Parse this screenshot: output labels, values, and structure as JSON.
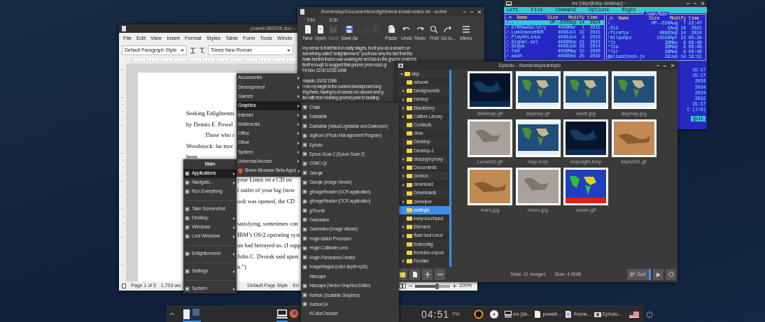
{
  "writer": {
    "title": "powell-082025.doc —",
    "menu": [
      "File",
      "Edit",
      "View",
      "Insert",
      "Format",
      "Styles",
      "Table",
      "Form",
      "Tools",
      "Windo"
    ],
    "paragraph_style": "Default Paragraph Style",
    "font_name": "Times New Roman",
    "paragraphs": [
      {
        "lines": [
          {
            "text": "Seeking Enlightenm",
            "indent": false
          },
          {
            "text": "by Dennis E. Powel",
            "indent": false
          },
          {
            "text": "Those who r",
            "indent": true
          },
          {
            "text": "Woodstock: far mor",
            "indent": false
          },
          {
            "text": "been.",
            "indent": false
          }
        ]
      },
      {
        "lines": [
          {
            "text": "your Linux on a CD ou",
            "indent": false
          },
          {
            "text": "l outlet of your big (now",
            "indent": false
          },
          {
            "text": "ook was opened, the CD",
            "indent": false
          }
        ]
      },
      {
        "lines": [
          {
            "text": "satisfying, sometimes con",
            "indent": false
          },
          {
            "text": "IBM’s OS/2 operating syst",
            "indent": false
          },
          {
            "text": "un had betrayed us. (I supp",
            "indent": false
          },
          {
            "text": "John C. Dvorak said upon",
            "indent": false
          },
          {
            "text": "n.”)",
            "indent": false
          }
        ]
      }
    ],
    "status": {
      "page": "Page 1 of 5",
      "words": "1,703 wo",
      "page_style": "Default Page Style",
      "language": "En"
    },
    "zoom": {
      "level": 0.62,
      "reading": "100%"
    }
  },
  "editor": {
    "title": "/home/dep/Documents/enlightment-email-notes.txt - ecrire",
    "menu": [
      "File",
      "Edit"
    ],
    "toolbar": [
      {
        "kind": "new",
        "label": "New",
        "disabled": false
      },
      {
        "kind": "open",
        "label": "Open",
        "disabled": false
      },
      {
        "kind": "save",
        "label": "Save",
        "disabled": true
      },
      {
        "kind": "save-as",
        "label": "Save As",
        "disabled": false
      },
      {
        "kind": "cut",
        "disabled": true
      },
      {
        "kind": "copy",
        "disabled": true
      },
      {
        "kind": "paste",
        "label": "Paste",
        "disabled": false
      },
      {
        "kind": "undo",
        "label": "Undo",
        "disabled": false
      },
      {
        "kind": "redo",
        "label": "Redo",
        "disabled": false
      },
      {
        "kind": "find",
        "label": "Find",
        "disabled": false
      },
      {
        "kind": "goto",
        "label": "Go to...",
        "disabled": false
      },
      {
        "kind": "menu",
        "label": "Menu",
        "disabled": false
      }
    ],
    "paragraphs": [
      {
        "lines": [
          "my sense is that this is in early stages, but if you do a search on",
          "something called \"enlightenment,\" you'll see why the fact that the",
          "brain behind that is now working for red hat on the gnome project is",
          "itself enough to suggest that gnome prom sosz gr",
          "Fri Nov 13 00:10:53 1998"
        ]
      },
      {
        "lines": [
          "massin, 01/02 1998",
          "t me my target is the current development ang",
          "ting there, having to of course run around and g",
          "ller with from building gnome) prior to tackling"
        ]
      }
    ]
  },
  "terminal": {
    "title": "mc [dep@dep-desktop]:~",
    "menu": [
      "Left",
      "File",
      "Command",
      "Options",
      "Right"
    ],
    "left_panel": {
      "columns": [
        ".n  Name",
        "Size",
        "Modify time"
      ],
      "rows": [
        {
          "name": "/..",
          "size": "UP--DIR",
          "modify": "Sep 14  2024",
          "selected": true
        },
        {
          "name": "/.GTKRawGallery",
          "size": "4096",
          "modify": "Mar  1  2015",
          "selected": false
        },
        {
          "name": "/.LuminanceHDR",
          "size": "4096",
          "modify": "Jul 22  2015",
          "selected": false
        },
        {
          "name": "/.PlayOnLinux",
          "size": "4096",
          "modify": "Jun  3  2019",
          "selected": false
        },
        {
          "name": "/.Signal.sel",
          "size": "4096",
          "modify": "Sep 21  2023",
          "selected": false
        },
        {
          "name": "/.Skype",
          "size": "4096",
          "modify": "Jun 28  2014",
          "selected": false
        },
        {
          "name": "/.Ted",
          "size": "4096",
          "modify": "May 15  2020",
          "selected": false
        },
        {
          "name": "/.aash",
          "size": "4096",
          "modify": "Dec 25  2019",
          "selected": false
        }
      ]
    },
    "right_panel": {
      "path": "/usr/bin",
      "columns": [
        ".n  Name",
        "Size",
        "Modify time"
      ],
      "rows": [
        {
          "name": "/..",
          "size": "UP--DIR",
          "modify": "Aug  7 22:47",
          "selected": false
        },
        {
          "name": "-X11",
          "size": "1",
          "modify": "Aug 18  2021",
          "selected": false
        },
        {
          "name": "/firefox",
          "size": "4096",
          "modify": "Sep 14  2024",
          "selected": false
        },
        {
          "name": "*AtlasOps",
          "size": "14558",
          "modify": "Apr 12 06:29",
          "selected": false
        },
        {
          "name": "*7z",
          "size": "36",
          "modify": "May  8 06:46",
          "selected": false
        },
        {
          "name": "*7za",
          "size": "36",
          "modify": "May  8 06:46",
          "selected": false
        },
        {
          "name": "*7zr",
          "size": "36",
          "modify": "May  8 06:46",
          "selected": false
        },
        {
          "name": "@aliasCheck-jv",
          "size": "28",
          "modify": "Jun 14 16:51",
          "selected": false
        }
      ]
    },
    "strip": [
      "15:17",
      "15:17",
      "2024",
      "2024",
      "2024",
      "2022",
      "15:17",
      "C (7/6)"
    ],
    "command_key": "Quit"
  },
  "photo_viewer": {
    "title": "Ephoto - /home/dep/earthpic",
    "tree": [
      {
        "label": "dep",
        "expandable": true,
        "expanded": true,
        "selected": false,
        "children": [
          {
            "label": "artwork",
            "expandable": false,
            "expanded": false,
            "selected": false
          },
          {
            "label": "backgrounds",
            "expandable": true,
            "expanded": false,
            "selected": false
          },
          {
            "label": "backup",
            "expandable": true,
            "expanded": false,
            "selected": false
          },
          {
            "label": "Blackberry",
            "expandable": true,
            "expanded": false,
            "selected": false
          },
          {
            "label": "Calibre Library",
            "expandable": true,
            "expanded": false,
            "selected": false
          },
          {
            "label": "Contacts",
            "expandable": false,
            "expanded": false,
            "selected": false
          },
          {
            "label": "drive",
            "expandable": false,
            "expanded": false,
            "selected": false
          },
          {
            "label": "Desktop",
            "expandable": false,
            "expanded": false,
            "selected": false
          },
          {
            "label": "Desktop-1",
            "expandable": false,
            "expanded": false,
            "selected": false
          },
          {
            "label": "dnscrypt-proxy",
            "expandable": true,
            "expanded": false,
            "selected": false
          },
          {
            "label": "Documents",
            "expandable": true,
            "expanded": false,
            "selected": false
          },
          {
            "label": "dosbox",
            "expandable": true,
            "expanded": false,
            "selected": false
          },
          {
            "label": "download",
            "expandable": true,
            "expanded": false,
            "selected": false
          },
          {
            "label": "Downloads",
            "expandable": false,
            "expanded": false,
            "selected": false
          },
          {
            "label": "dwhelper",
            "expandable": true,
            "expanded": false,
            "selected": false
          },
          {
            "label": "earthpic",
            "expandable": false,
            "expanded": false,
            "selected": true
          },
          {
            "label": "easy-touchpad",
            "expandable": false,
            "expanded": false,
            "selected": false
          },
          {
            "label": "Element",
            "expandable": true,
            "expanded": false,
            "selected": false
          },
          {
            "label": "flash tool Linux",
            "expandable": true,
            "expanded": false,
            "selected": false
          },
          {
            "label": "fontconfig",
            "expandable": false,
            "expanded": false,
            "selected": false
          },
          {
            "label": "freetube-export",
            "expandable": false,
            "expanded": false,
            "selected": false
          },
          {
            "label": "Frontier",
            "expandable": true,
            "expanded": false,
            "selected": false
          }
        ]
      }
    ],
    "thumbnails": [
      {
        "file": "darkmap.gif",
        "kind": "night"
      },
      {
        "file": "daymap.gif",
        "kind": "day"
      },
      {
        "file": "earth.jpg",
        "kind": "day"
      },
      {
        "file": "daymap.jpg",
        "kind": "day"
      },
      {
        "file": "Luna400.gif",
        "kind": "moon"
      },
      {
        "file": "map.bmp",
        "kind": "day"
      },
      {
        "file": "mapnight.bmp",
        "kind": "night"
      },
      {
        "file": "Mars400.gif",
        "kind": "mars"
      },
      {
        "file": "mars.jpg",
        "kind": "mars"
      },
      {
        "file": "moon.jpg",
        "kind": "moon"
      },
      {
        "file": "ocean.gif",
        "kind": "ocean"
      }
    ],
    "total": "Total: 11 images",
    "size": "Size: 4.9MB",
    "sort": "Sort"
  },
  "main_menu": {
    "title": "Main",
    "items": [
      {
        "kind": "item",
        "label": "Applications",
        "submenu": true,
        "selected": true
      },
      {
        "kind": "item",
        "label": "Navigate...",
        "submenu": true,
        "selected": false
      },
      {
        "kind": "item",
        "label": "Run Everything",
        "submenu": false,
        "selected": false
      },
      {
        "kind": "separator"
      },
      {
        "kind": "item",
        "label": "Take Screenshot",
        "submenu": false,
        "selected": false
      },
      {
        "kind": "item",
        "label": "Desktop",
        "submenu": true,
        "selected": false
      },
      {
        "kind": "item",
        "label": "Windows",
        "submenu": true,
        "selected": false
      },
      {
        "kind": "item",
        "label": "Lost Windows",
        "submenu": true,
        "selected": false
      },
      {
        "kind": "separator"
      },
      {
        "kind": "item",
        "label": "Enlightenment",
        "submenu": true,
        "selected": false
      },
      {
        "kind": "separator"
      },
      {
        "kind": "item",
        "label": "Settings",
        "submenu": true,
        "selected": false
      },
      {
        "kind": "separator"
      },
      {
        "kind": "item",
        "label": "System",
        "submenu": true,
        "selected": false
      }
    ]
  },
  "applications_menu": [
    {
      "label": "Accessories",
      "icon": false,
      "selected": false
    },
    {
      "label": "Development",
      "icon": false,
      "selected": false
    },
    {
      "label": "Games",
      "icon": false,
      "selected": false
    },
    {
      "label": "Graphics",
      "icon": false,
      "selected": true
    },
    {
      "label": "Internet",
      "icon": false,
      "selected": false
    },
    {
      "label": "Multimedia",
      "icon": false,
      "selected": false
    },
    {
      "label": "Office",
      "icon": false,
      "selected": false
    },
    {
      "label": "Other",
      "icon": false,
      "selected": false
    },
    {
      "label": "System",
      "icon": false,
      "selected": false
    },
    {
      "label": "Universal Access",
      "icon": false,
      "selected": false
    },
    {
      "label": "Brave Browser Beta Apps",
      "icon": true,
      "selected": false
    }
  ],
  "graphics_menu": [
    {
      "label": "Chalk",
      "icon": true
    },
    {
      "label": "Darktable",
      "icon": true
    },
    {
      "label": "Darktable (Virtual Lighttable and Darkroom)",
      "icon": true
    },
    {
      "label": "digiKam (Photo Management Program)",
      "icon": true
    },
    {
      "label": "Ephoto",
      "icon": true
    },
    {
      "label": "Epson Scan 2 (Epson Scan 2)",
      "icon": true
    },
    {
      "label": "G'MIC-Qt",
      "icon": true
    },
    {
      "label": "Geeqie",
      "icon": true
    },
    {
      "label": "Geeqie (Image Viewer)",
      "icon": true
    },
    {
      "label": "gImageReader (OCR application)",
      "icon": true
    },
    {
      "label": "gImageReader (OCR application)",
      "icon": true
    },
    {
      "label": "gThumb",
      "icon": true
    },
    {
      "label": "Gwenview",
      "icon": true
    },
    {
      "label": "Gwenview (Image Viewer)",
      "icon": true
    },
    {
      "label": "Hugin Batch Processor",
      "icon": true
    },
    {
      "label": "Hugin Calibrate Lens",
      "icon": true
    },
    {
      "label": "Hugin Panorama Creator",
      "icon": true
    },
    {
      "label": "ImageMagick (color depth=q16)",
      "icon": true
    },
    {
      "label": "Inkscape",
      "icon": false
    },
    {
      "label": "Inkscape (Vector Graphics Editor)",
      "icon": true
    },
    {
      "label": "Karbon (Scalable Graphics)",
      "icon": true
    },
    {
      "label": "Karbon14",
      "icon": true
    },
    {
      "label": "KColorChooser",
      "icon": false
    }
  ],
  "taskbar": {
    "launchers": [
      {
        "kind": "terminal",
        "active": true
      },
      {
        "kind": "browser",
        "active": false
      }
    ],
    "clock": "04:51",
    "meridiem": "PM",
    "tasks": [
      {
        "kind": "terminal",
        "label": "mc [de..."
      },
      {
        "kind": "document",
        "label": "powell-..."
      },
      {
        "kind": "text",
        "label": "/home..."
      },
      {
        "kind": "photo",
        "label": "Ephoto..."
      }
    ]
  }
}
